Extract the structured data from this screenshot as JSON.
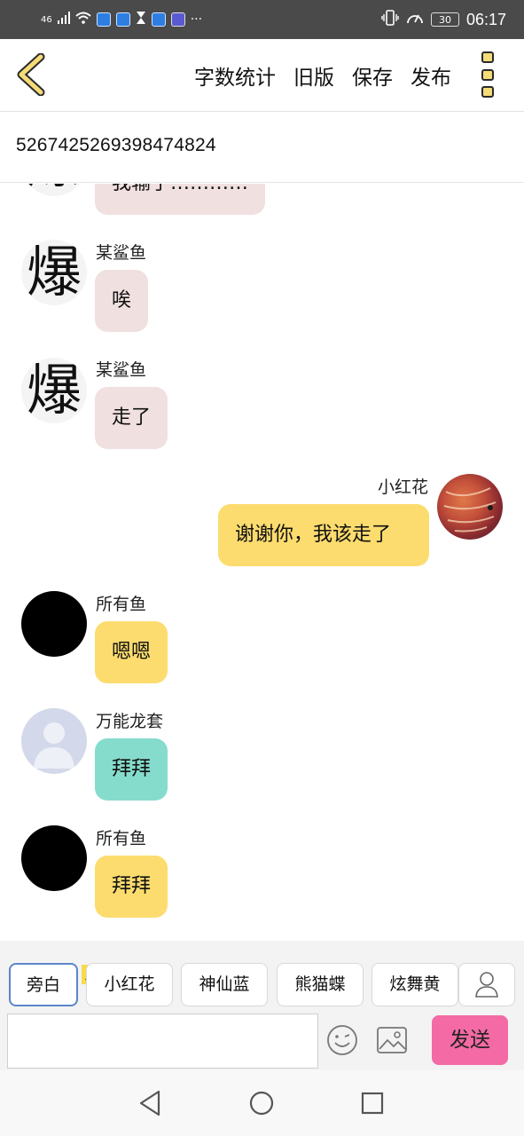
{
  "status_bar": {
    "network": "46",
    "more": "···",
    "battery": "30",
    "time": "06:17"
  },
  "toolbar": {
    "actions": [
      "字数统计",
      "旧版",
      "保存",
      "发布"
    ],
    "colors": {
      "accent": "#f5dc78"
    }
  },
  "document": {
    "title": "5267425269398474824"
  },
  "messages": [
    {
      "sender": "",
      "text": "我输了…………",
      "bubble_color": "#f1e0e0",
      "side": "left",
      "avatar": "爆"
    },
    {
      "sender": "某鲨鱼",
      "text": "唉",
      "bubble_color": "#f1e0e0",
      "side": "left",
      "avatar": "爆"
    },
    {
      "sender": "某鲨鱼",
      "text": "走了",
      "bubble_color": "#f1e0e0",
      "side": "left",
      "avatar": "爆"
    },
    {
      "sender": "小红花",
      "text": "谢谢你，我该走了",
      "bubble_color": "#fcdc6e",
      "side": "right",
      "avatar": "fish-photo"
    },
    {
      "sender": "所有鱼",
      "text": "嗯嗯",
      "bubble_color": "#fcdc6e",
      "side": "left",
      "avatar": "black-circle"
    },
    {
      "sender": "万能龙套",
      "text": "拜拜",
      "bubble_color": "#86dccc",
      "side": "left",
      "avatar": "default-person"
    },
    {
      "sender": "所有鱼",
      "text": "拜拜",
      "bubble_color": "#fcdc6e",
      "side": "left",
      "avatar": "black-circle"
    }
  ],
  "roles": {
    "items": [
      "旁白",
      "小红花",
      "神仙蓝",
      "熊猫蝶",
      "炫舞黄"
    ],
    "host_badge": "主",
    "selected": "旁白"
  },
  "composer": {
    "placeholder": "",
    "send_label": "发送",
    "send_color": "#f36aa4"
  },
  "icons": {
    "back": "chevron-left-icon",
    "more": "more-vertical-icon",
    "emoji": "emoji-icon",
    "image": "image-icon",
    "add_role": "person-icon",
    "nav": [
      "back-triangle-icon",
      "home-circle-icon",
      "recents-square-icon"
    ]
  }
}
